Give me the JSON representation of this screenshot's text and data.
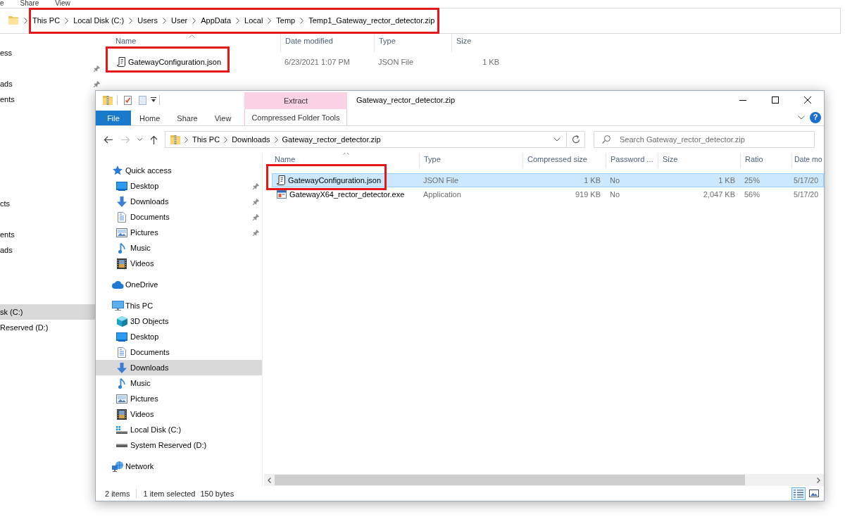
{
  "background_window": {
    "ribbon_tabs": [
      {
        "label": "e"
      },
      {
        "label": "Share"
      },
      {
        "label": "View"
      }
    ],
    "address": {
      "highlighted": true,
      "crumbs": [
        "This PC",
        "Local Disk (C:)",
        "Users",
        "User",
        "AppData",
        "Local",
        "Temp",
        "Temp1_Gateway_rector_detector.zip"
      ]
    },
    "sidebar": [
      {
        "label": "ess",
        "pinned": false,
        "selected": false
      },
      {
        "pinned": true
      },
      {
        "label": "ads",
        "pinned": true,
        "selected": false
      },
      {
        "label": "ents",
        "pinned": false,
        "selected": false
      },
      {
        "label": "cts",
        "pinned": false,
        "selected": false
      },
      {
        "label": "ents",
        "pinned": false,
        "selected": false
      },
      {
        "label": "ads",
        "pinned": false,
        "selected": false
      },
      {
        "label": "sk (C:)",
        "pinned": false,
        "selected": true
      },
      {
        "label": "Reserved (D:)",
        "pinned": false,
        "selected": false
      }
    ],
    "columns": [
      {
        "label": "Name",
        "kind": "name",
        "sorted": true
      },
      {
        "label": "Date modified",
        "kind": "text",
        "sorted": false
      },
      {
        "label": "Type",
        "kind": "text",
        "sorted": false
      },
      {
        "label": "Size",
        "kind": "number",
        "sorted": false
      }
    ],
    "rows": [
      {
        "kind": "json",
        "selected": false,
        "highlighted": true,
        "cells": [
          "GatewayConfiguration.json",
          "6/23/2021 1:07 PM",
          "JSON File",
          "1 KB"
        ]
      }
    ]
  },
  "window": {
    "title": "Gateway_rector_detector.zip",
    "context_tab": {
      "label": "Extract"
    },
    "ribbon_tabs": [
      {
        "label": "File",
        "kind": "file"
      },
      {
        "label": "Home",
        "kind": "tab"
      },
      {
        "label": "Share",
        "kind": "tab"
      },
      {
        "label": "View",
        "kind": "tab"
      },
      {
        "label": "Compressed Folder Tools",
        "kind": "contextual"
      }
    ],
    "help": {
      "label": "?"
    }
  },
  "nav_buttons": [
    {
      "kind": "back",
      "disabled": false
    },
    {
      "kind": "forward",
      "disabled": true
    },
    {
      "kind": "recent",
      "disabled": false
    },
    {
      "kind": "up",
      "disabled": false
    }
  ],
  "address": {
    "crumbs": [
      "This PC",
      "Downloads",
      "Gateway_rector_detector.zip"
    ]
  },
  "search": {
    "placeholder": "Search Gateway_rector_detector.zip"
  },
  "sidebar": [
    {
      "label": "Quick access",
      "kind": "star",
      "selected": false,
      "children": [
        {
          "label": "Desktop",
          "kind": "desktop",
          "selected": false,
          "pinned": true
        },
        {
          "label": "Downloads",
          "kind": "downloads",
          "selected": false,
          "pinned": true
        },
        {
          "label": "Documents",
          "kind": "documents",
          "selected": false,
          "pinned": true
        },
        {
          "label": "Pictures",
          "kind": "pictures",
          "selected": false,
          "pinned": true
        },
        {
          "label": "Music",
          "kind": "music",
          "selected": false,
          "pinned": false
        },
        {
          "label": "Videos",
          "kind": "videos",
          "selected": false,
          "pinned": false
        }
      ]
    },
    {
      "label": "OneDrive",
      "kind": "cloud",
      "selected": false
    },
    {
      "label": "This PC",
      "kind": "computer",
      "selected": false,
      "children": [
        {
          "label": "3D Objects",
          "kind": "objects",
          "selected": false,
          "pinned": false
        },
        {
          "label": "Desktop",
          "kind": "desktop",
          "selected": false,
          "pinned": false
        },
        {
          "label": "Documents",
          "kind": "documents",
          "selected": false,
          "pinned": false
        },
        {
          "label": "Downloads",
          "kind": "downloads",
          "selected": true,
          "pinned": false
        },
        {
          "label": "Music",
          "kind": "music",
          "selected": false,
          "pinned": false
        },
        {
          "label": "Pictures",
          "kind": "pictures",
          "selected": false,
          "pinned": false
        },
        {
          "label": "Videos",
          "kind": "videos",
          "selected": false,
          "pinned": false
        },
        {
          "label": "Local Disk (C:)",
          "kind": "disk",
          "selected": false,
          "pinned": false
        },
        {
          "label": "System Reserved (D:)",
          "kind": "drive",
          "selected": false,
          "pinned": false
        }
      ]
    },
    {
      "label": "Network",
      "kind": "network",
      "selected": false
    }
  ],
  "table": {
    "columns": [
      {
        "label": "Name",
        "kind": "name",
        "sorted": true
      },
      {
        "label": "Type",
        "kind": "text",
        "sorted": false
      },
      {
        "label": "Compressed size",
        "kind": "number",
        "sorted": false
      },
      {
        "label": "Password ...",
        "kind": "text",
        "sorted": false
      },
      {
        "label": "Size",
        "kind": "number",
        "sorted": false
      },
      {
        "label": "Ratio",
        "kind": "text",
        "sorted": false
      },
      {
        "label": "Date mo",
        "kind": "text",
        "sorted": false
      }
    ],
    "rows": [
      {
        "kind": "json",
        "selected": true,
        "highlighted": true,
        "cells": [
          "GatewayConfiguration.json",
          "JSON File",
          "1 KB",
          "No",
          "1 KB",
          "25%",
          "5/17/20"
        ]
      },
      {
        "kind": "exe",
        "selected": false,
        "highlighted": false,
        "cells": [
          "GatewayX64_rector_detector.exe",
          "Application",
          "919 KB",
          "No",
          "2,047 KB",
          "56%",
          "5/17/20"
        ]
      }
    ]
  },
  "status_bar": {
    "count": "2 items",
    "selection": "1 item selected",
    "size": "150 bytes",
    "views": [
      {
        "kind": "details",
        "selected": true
      },
      {
        "kind": "large-icons",
        "selected": false
      }
    ]
  }
}
